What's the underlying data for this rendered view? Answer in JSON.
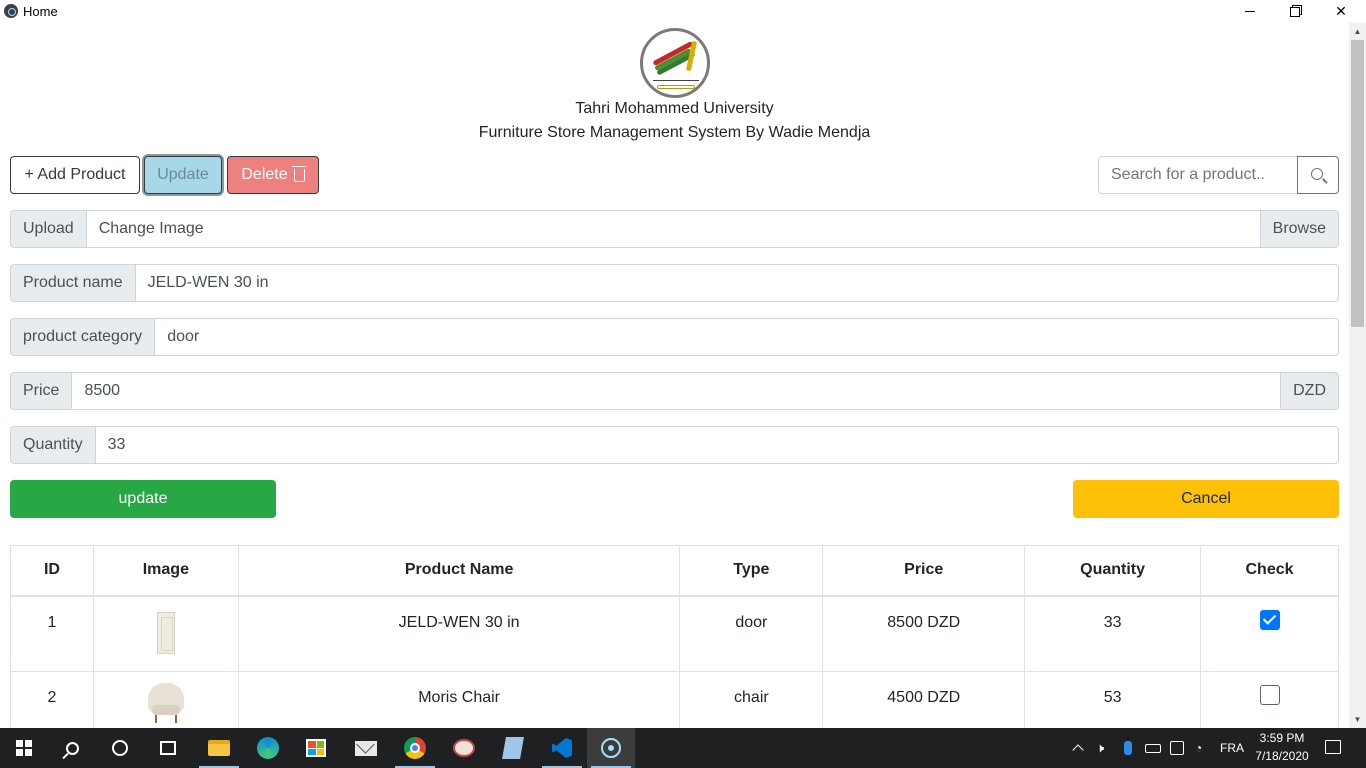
{
  "window": {
    "title": "Home"
  },
  "header": {
    "university": "Tahri Mohammed University",
    "system": "Furniture Store Management System By Wadie Mendja"
  },
  "toolbar": {
    "add_label": "+ Add Product",
    "update_label": "Update",
    "delete_label": "Delete",
    "search_placeholder": "Search for a product.."
  },
  "form": {
    "upload": {
      "label": "Upload",
      "value": "Change Image",
      "button": "Browse"
    },
    "name": {
      "label": "Product name",
      "value": "JELD-WEN 30 in"
    },
    "category": {
      "label": "product category",
      "value": "door"
    },
    "price": {
      "label": "Price",
      "value": "8500",
      "unit": "DZD"
    },
    "quantity": {
      "label": "Quantity",
      "value": "33"
    },
    "update_button": "update",
    "cancel_button": "Cancel"
  },
  "table": {
    "headers": [
      "ID",
      "Image",
      "Product Name",
      "Type",
      "Price",
      "Quantity",
      "Check"
    ],
    "rows": [
      {
        "id": "1",
        "image": "door-image",
        "name": "JELD-WEN 30 in",
        "type": "door",
        "price": "8500 DZD",
        "quantity": "33",
        "checked": true
      },
      {
        "id": "2",
        "image": "chair-image",
        "name": "Moris Chair",
        "type": "chair",
        "price": "4500 DZD",
        "quantity": "53",
        "checked": false
      }
    ]
  },
  "taskbar": {
    "language": "FRA",
    "time": "3:59 PM",
    "date": "7/18/2020"
  },
  "colors": {
    "success": "#28a745",
    "warning": "#ffc107",
    "info_light": "#a8d8e8",
    "danger_light": "#ef8080",
    "taskbar": "#1f2021"
  }
}
